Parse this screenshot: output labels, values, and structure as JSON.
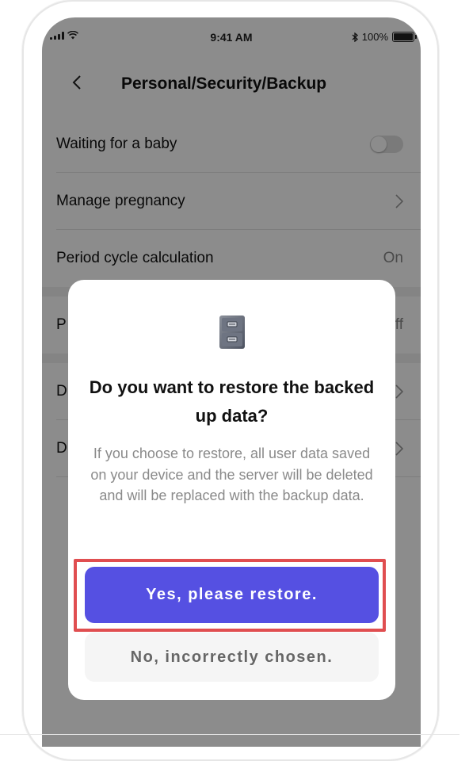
{
  "status_bar": {
    "time": "9:41 AM",
    "battery": "100%",
    "battery_level": 1.0
  },
  "nav": {
    "title": "Personal/Security/Backup"
  },
  "list": {
    "rows": [
      {
        "label": "Waiting for a baby",
        "toggle_on": false
      },
      {
        "label": "Manage pregnancy"
      },
      {
        "label": "Period cycle calculation",
        "value": "On"
      },
      {
        "label": "P",
        "value": "ff"
      },
      {
        "label": "D"
      },
      {
        "label": "D"
      }
    ]
  },
  "dialog": {
    "icon": "file-cabinet-icon",
    "title": "Do you want to restore the backed up data?",
    "body": "If you choose to restore, all user data saved on your device and the server will be deleted and will be replaced with the backup data.",
    "primary_label": "Yes, please restore.",
    "secondary_label": "No, incorrectly chosen."
  },
  "colors": {
    "primary": "#5550e2",
    "highlight": "#e04e50",
    "overlay": "rgba(0,0,0,0.45)"
  }
}
